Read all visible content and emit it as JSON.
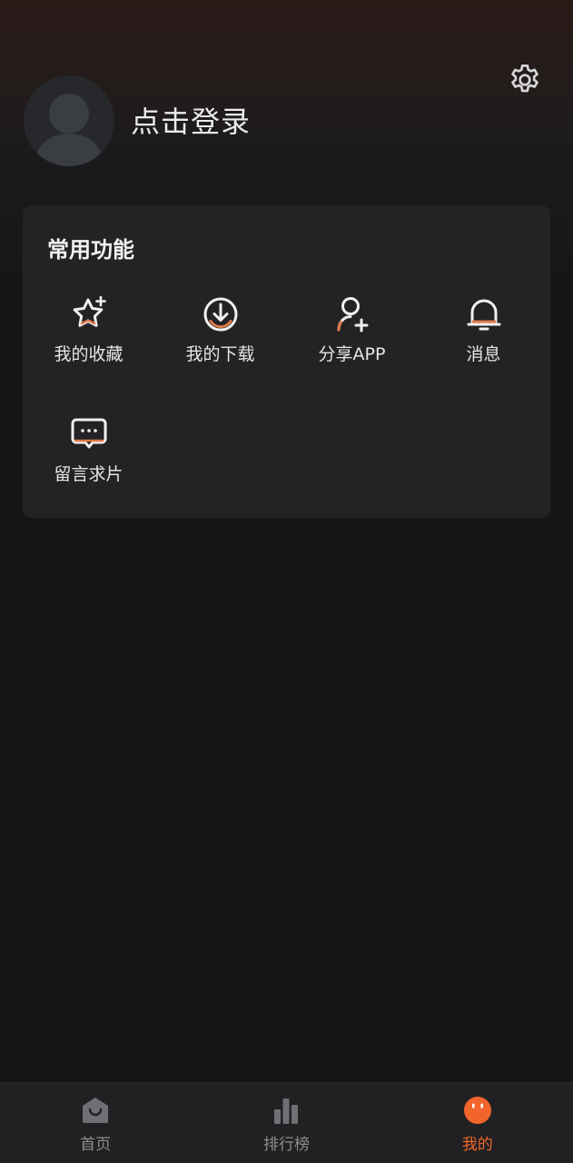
{
  "header": {
    "login_label": "点击登录"
  },
  "common": {
    "title": "常用功能",
    "items": [
      {
        "label": "我的收藏",
        "icon": "star-sparkle-icon"
      },
      {
        "label": "我的下载",
        "icon": "download-icon"
      },
      {
        "label": "分享APP",
        "icon": "add-user-icon"
      },
      {
        "label": "消息",
        "icon": "bell-icon"
      },
      {
        "label": "留言求片",
        "icon": "chat-icon"
      }
    ]
  },
  "tabbar": {
    "items": [
      {
        "label": "首页",
        "icon": "home-icon",
        "active": false
      },
      {
        "label": "排行榜",
        "icon": "bar-chart-icon",
        "active": false
      },
      {
        "label": "我的",
        "icon": "face-icon",
        "active": true
      }
    ]
  },
  "colors": {
    "accent": "#f2652a",
    "icon_accent": "#e07a4a",
    "card": "#232325",
    "background": "#151618"
  }
}
